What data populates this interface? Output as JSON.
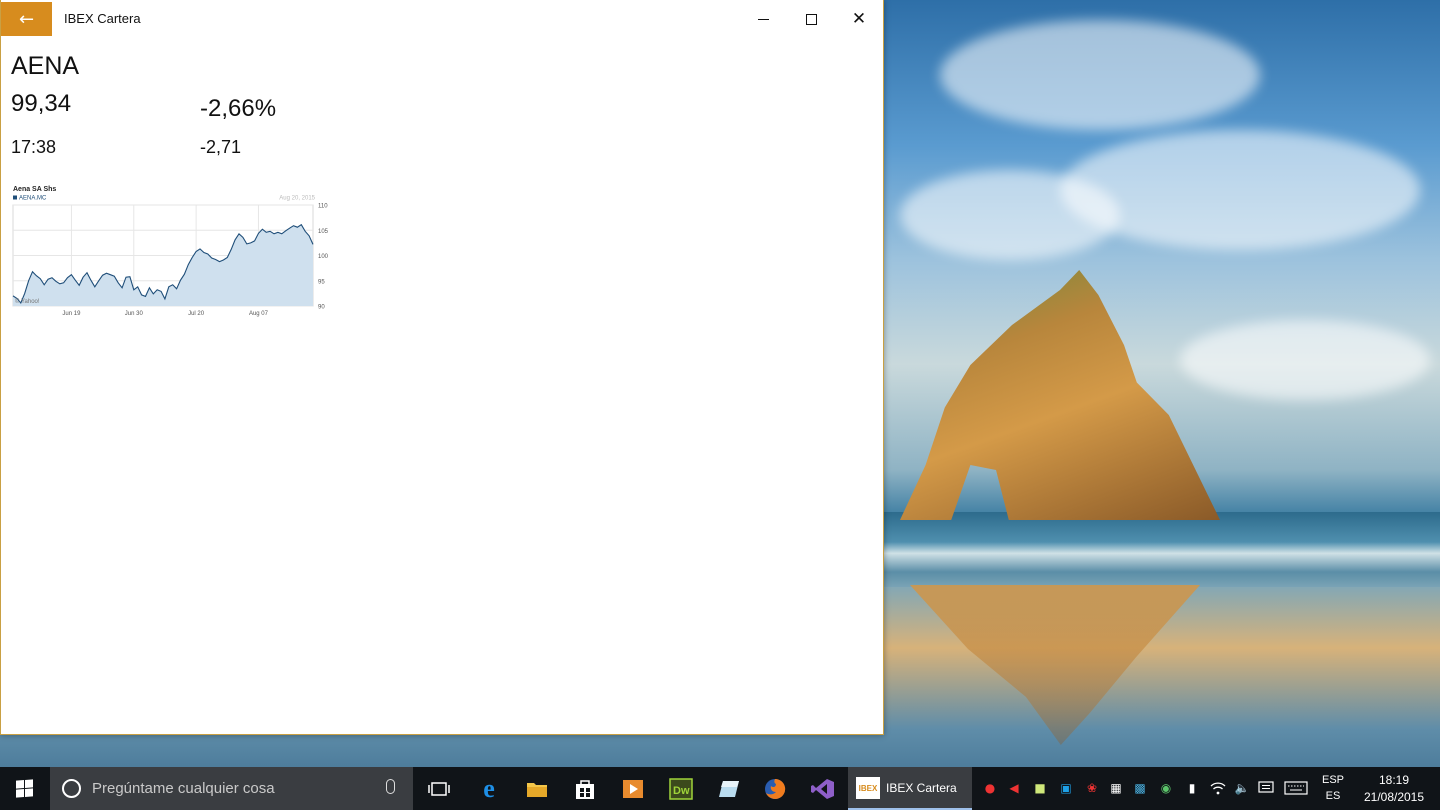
{
  "window": {
    "title": "IBEX Cartera",
    "back_icon": "back-arrow-icon",
    "accent": "#d78c1e"
  },
  "quote": {
    "symbol": "AENA",
    "price": "99,34",
    "change_pct": "-2,66%",
    "time": "17:38",
    "change": "-2,71"
  },
  "chart_data": {
    "type": "area",
    "title": "Aena SA Shs",
    "legend": "AENA.MC",
    "date_label": "Aug 20, 2015",
    "watermark": "© Yahoo!",
    "x_ticks": [
      "Jun 19",
      "Jun 30",
      "Jul 20",
      "Aug 07"
    ],
    "y_ticks": [
      110,
      105,
      100,
      95,
      90
    ],
    "ylim": [
      90,
      110
    ],
    "color": "#1f4e79",
    "fill": "#cfe0ee",
    "values": [
      92,
      91.5,
      90.6,
      92.5,
      95,
      96.8,
      96,
      95.4,
      94.2,
      95.3,
      95.6,
      94.9,
      94.4,
      94.6,
      95.6,
      96.2,
      95.1,
      94.1,
      95.7,
      96.6,
      95.1,
      93.8,
      95,
      96.1,
      96.5,
      96.2,
      95.9,
      94.6,
      93.6,
      95.7,
      95.8,
      93.2,
      93.8,
      92.2,
      91.9,
      93.6,
      92.4,
      93.2,
      92.9,
      91.4,
      93.8,
      94.2,
      93.4,
      95.1,
      96.3,
      98.2,
      99.6,
      100.8,
      101.3,
      100.6,
      100.3,
      99.5,
      99.2,
      98.8,
      99.1,
      99.6,
      101.2,
      103.1,
      104.3,
      103.6,
      102.3,
      102.5,
      102.9,
      104.4,
      105.2,
      104.6,
      104.8,
      104.3,
      104.6,
      104.3,
      104.9,
      105.4,
      105.9,
      105.6,
      106.1,
      104.8,
      103.9,
      102.2
    ]
  },
  "taskbar": {
    "search_placeholder": "Pregúntame cualquier cosa",
    "active_app_label": "IBEX Cartera",
    "active_app_logo": "IBEX",
    "lang_line1": "ESP",
    "lang_line2": "ES",
    "time": "18:19",
    "date": "21/08/2015"
  }
}
